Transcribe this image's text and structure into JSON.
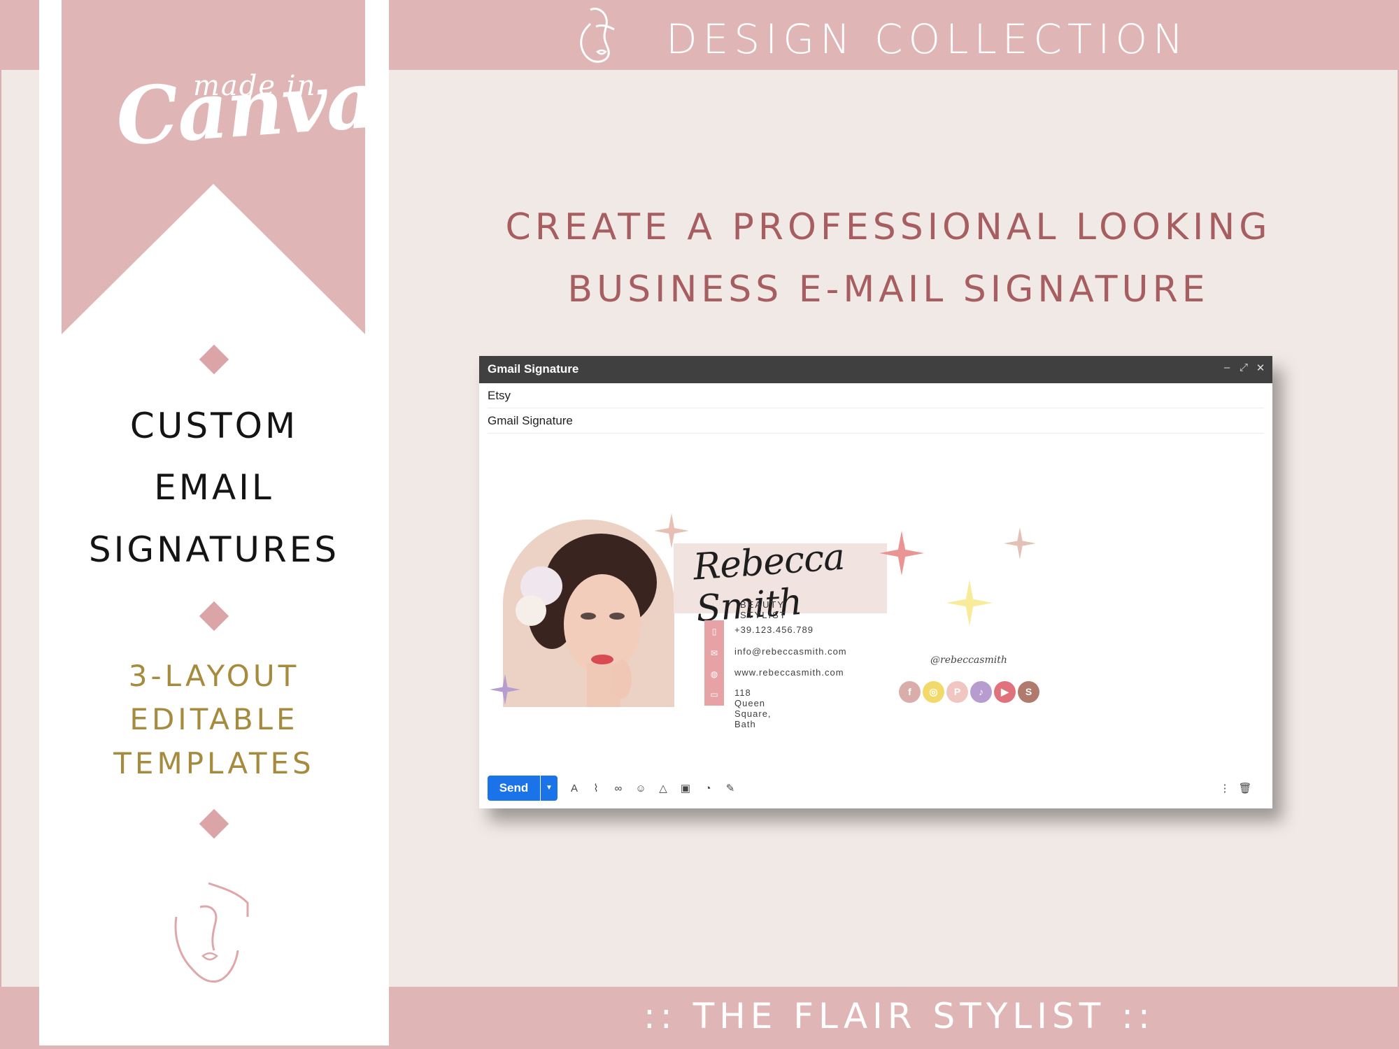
{
  "header": {
    "title": "DESIGN COLLECTION"
  },
  "footer": {
    "title": ":: THE FLAIR STYLIST ::"
  },
  "left_panel": {
    "made_in": "made in",
    "canva": "Canva",
    "title_lines": [
      "CUSTOM",
      "EMAIL",
      "SIGNATURES"
    ],
    "subtitle_lines": [
      "3-LAYOUT",
      "EDITABLE",
      "TEMPLATES"
    ]
  },
  "headline": {
    "line1": "CREATE A PROFESSIONAL LOOKING",
    "line2": "BUSINESS E-MAIL SIGNATURE"
  },
  "gmail": {
    "window_title": "Gmail Signature",
    "to": "Etsy",
    "subject": "Gmail Signature",
    "send_label": "Send",
    "controls": [
      "minimize-icon",
      "pop-out-icon",
      "close-icon"
    ],
    "toolbar_icons": [
      "text-format-icon",
      "attach-icon",
      "link-icon",
      "emoji-icon",
      "drive-icon",
      "photo-icon",
      "confidential-icon",
      "signature-icon"
    ],
    "signature": {
      "name": "Rebecca Smith",
      "role": "BEAUTY STYLIST",
      "phone": "+39.123.456.789",
      "email": "info@rebeccasmith.com",
      "website": "www.rebeccasmith.com",
      "address": "118 Queen Square, Bath",
      "handle": "@rebeccasmith",
      "socials": [
        {
          "icon": "facebook-icon",
          "glyph": "f",
          "color": "#d9aeaa"
        },
        {
          "icon": "instagram-icon",
          "glyph": "◎",
          "color": "#f3d86a"
        },
        {
          "icon": "pinterest-icon",
          "glyph": "P",
          "color": "#f0c6c2"
        },
        {
          "icon": "tiktok-icon",
          "glyph": "♪",
          "color": "#b79ccf"
        },
        {
          "icon": "youtube-icon",
          "glyph": "▶",
          "color": "#e0727d"
        },
        {
          "icon": "skype-icon",
          "glyph": "S",
          "color": "#b07a6d"
        }
      ]
    }
  },
  "colors": {
    "band": "#e0b5b6",
    "background": "#f1e9e6",
    "headline": "#a65e60",
    "subtitle_gold": "#a68a3e",
    "send_blue": "#1a73e8"
  }
}
